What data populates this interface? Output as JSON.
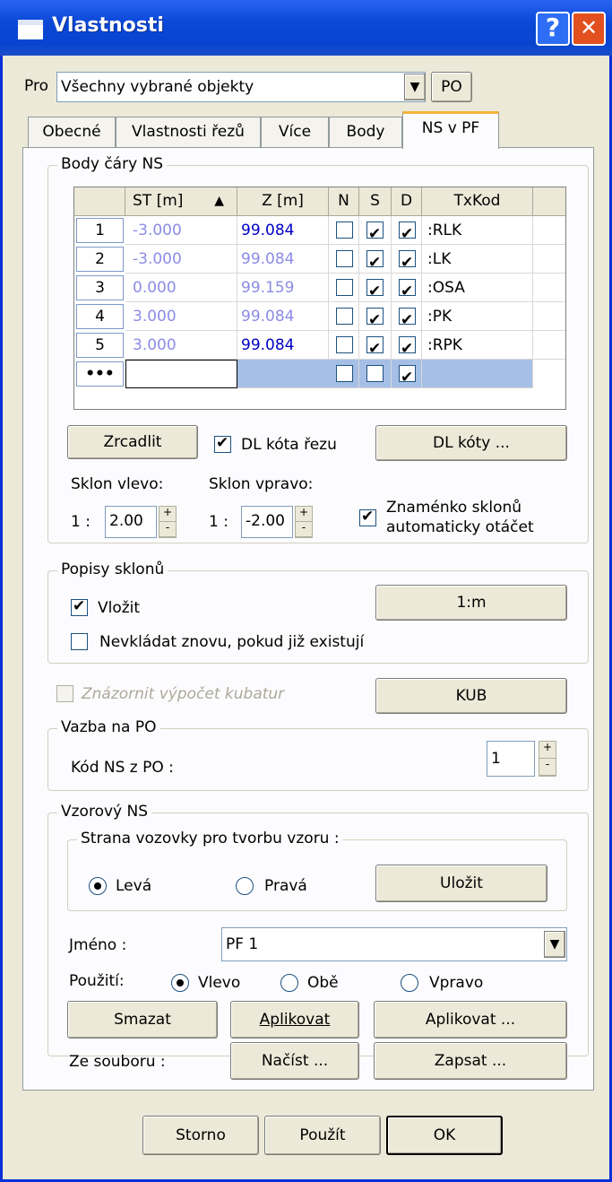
{
  "window": {
    "title": "Vlastnosti",
    "help_label": "?",
    "close_label": "✕"
  },
  "pro": {
    "label": "Pro",
    "value": "Všechny vybrané objekty",
    "po_button": "PO"
  },
  "tabs": [
    "Obecné",
    "Vlastnosti řezů",
    "Více",
    "Body",
    "NS v PF"
  ],
  "body_cary": {
    "caption": "Body čáry NS",
    "headers": {
      "st": "ST [m]",
      "z": "Z [m]",
      "n": "N",
      "s": "S",
      "d": "D",
      "txkod": "TxKod"
    },
    "sort_indicator": "▲",
    "rows": [
      {
        "num": "1",
        "st": "-3.000",
        "z": "99.084",
        "n": false,
        "s": true,
        "d": true,
        "txkod": ":RLK"
      },
      {
        "num": "2",
        "st": "-3.000",
        "z": "99.084",
        "n": false,
        "s": true,
        "d": true,
        "txkod": ":LK"
      },
      {
        "num": "3",
        "st": "0.000",
        "z": "99.159",
        "n": false,
        "s": true,
        "d": true,
        "txkod": ":OSA"
      },
      {
        "num": "4",
        "st": "3.000",
        "z": "99.084",
        "n": false,
        "s": true,
        "d": true,
        "txkod": ":PK"
      },
      {
        "num": "5",
        "st": "3.000",
        "z": "99.084",
        "n": false,
        "s": true,
        "d": true,
        "txkod": ":RPK"
      }
    ],
    "new_row_marker": "•••",
    "zrcadlit": "Zrcadlit",
    "dl_kota_rezu": "DL kóta řezu",
    "dl_koty": "DL kóty ...",
    "sklon_vlevo_label": "Sklon vlevo:",
    "sklon_vpravo_label": "Sklon vpravo:",
    "ratio_prefix": "1 :",
    "sklon_vlevo": "2.00",
    "sklon_vpravo": "-2.00",
    "znamenko_line1": "Znaménko sklonů",
    "znamenko_line2": "automaticky otáčet"
  },
  "popisy": {
    "caption": "Popisy sklonů",
    "vlozit": "Vložit",
    "one_m": "1:m",
    "nevkladat": "Nevkládat znovu, pokud již existují"
  },
  "kubatur": {
    "label": "Znázornit výpočet kubatur",
    "kub": "KUB"
  },
  "vazba": {
    "caption": "Vazba na PO",
    "kod_label": "Kód NS z PO :",
    "kod_value": "1"
  },
  "vzorovy": {
    "caption": "Vzorový NS",
    "strana_caption": "Strana vozovky pro tvorbu vzoru :",
    "leva": "Levá",
    "prava": "Pravá",
    "ulozit": "Uložit",
    "jmeno_label": "Jméno :",
    "jmeno_value": "PF 1",
    "pouziti_label": "Použití:",
    "vlevo": "Vlevo",
    "obe": "Obě",
    "vpravo": "Vpravo",
    "smazat": "Smazat",
    "aplikovat": "Aplikovat",
    "aplikovat_more": "Aplikovat ...",
    "ze_souboru": "Ze souboru :",
    "nacist": "Načíst ...",
    "zapsat": "Zapsat ..."
  },
  "footer": {
    "storno": "Storno",
    "pouzit": "Použít",
    "ok": "OK"
  }
}
